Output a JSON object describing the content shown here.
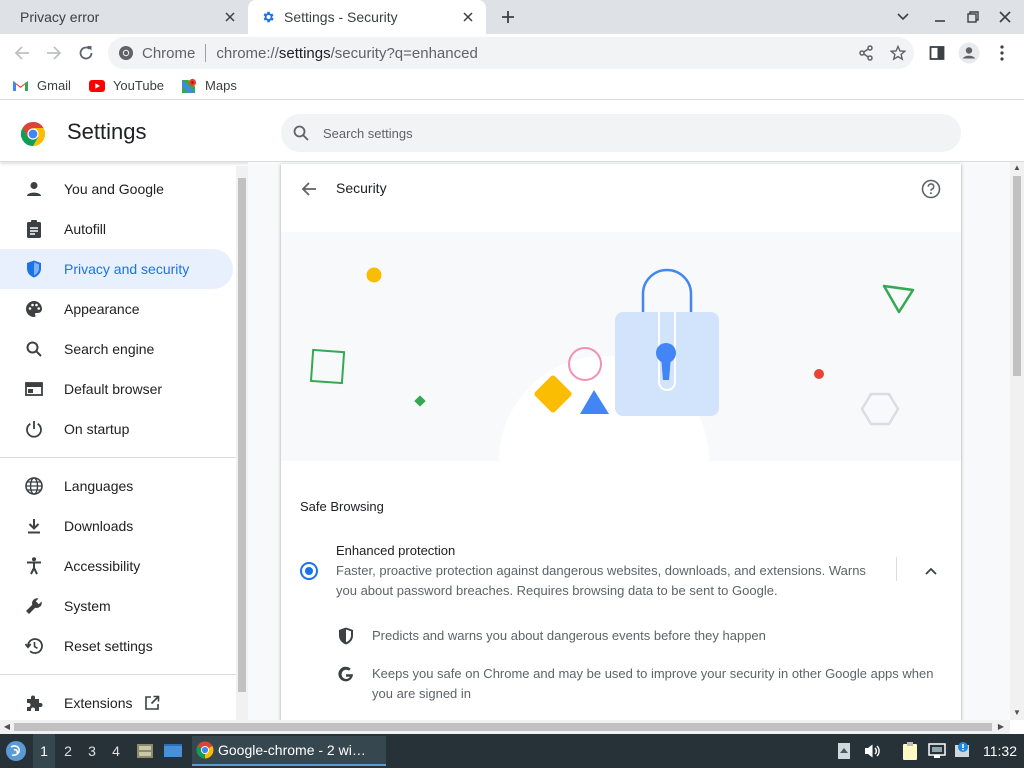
{
  "tabs": [
    {
      "title": "Privacy error"
    },
    {
      "title": "Settings - Security"
    }
  ],
  "toolbar": {
    "site_label": "Chrome",
    "url_prefix": "chrome://",
    "url_host": "settings",
    "url_path": "/security?q=enhanced"
  },
  "bookmarks": [
    {
      "label": "Gmail"
    },
    {
      "label": "YouTube"
    },
    {
      "label": "Maps"
    }
  ],
  "settings": {
    "title": "Settings",
    "search_placeholder": "Search settings"
  },
  "sidebar": {
    "items": [
      {
        "label": "You and Google",
        "icon": "person-icon"
      },
      {
        "label": "Autofill",
        "icon": "clipboard-icon"
      },
      {
        "label": "Privacy and security",
        "icon": "shield-icon",
        "active": true
      },
      {
        "label": "Appearance",
        "icon": "palette-icon"
      },
      {
        "label": "Search engine",
        "icon": "search-icon"
      },
      {
        "label": "Default browser",
        "icon": "browser-icon"
      },
      {
        "label": "On startup",
        "icon": "power-icon"
      },
      {
        "label": "Languages",
        "icon": "globe-icon"
      },
      {
        "label": "Downloads",
        "icon": "download-icon"
      },
      {
        "label": "Accessibility",
        "icon": "accessibility-icon"
      },
      {
        "label": "System",
        "icon": "wrench-icon"
      },
      {
        "label": "Reset settings",
        "icon": "history-icon"
      },
      {
        "label": "Extensions",
        "icon": "puzzle-icon"
      }
    ]
  },
  "security": {
    "title": "Security",
    "section_title": "Safe Browsing",
    "option": {
      "title": "Enhanced protection",
      "description": "Faster, proactive protection against dangerous websites, downloads, and extensions. Warns you about password breaches. Requires browsing data to be sent to Google.",
      "selected": true
    },
    "features": [
      {
        "text": "Predicts and warns you about dangerous events before they happen",
        "icon": "shield-icon"
      },
      {
        "text": "Keeps you safe on Chrome and may be used to improve your security in other Google apps when you are signed in",
        "icon": "google-g-icon"
      }
    ]
  },
  "taskbar": {
    "workspaces": [
      "1",
      "2",
      "3",
      "4"
    ],
    "active_workspace": "1",
    "window_title": "Google-chrome - 2 wi…",
    "clock": "11:32"
  },
  "colors": {
    "accent": "#1a73e8",
    "active_nav_bg": "#e8f0fe",
    "taskbar_bg": "#263238"
  }
}
